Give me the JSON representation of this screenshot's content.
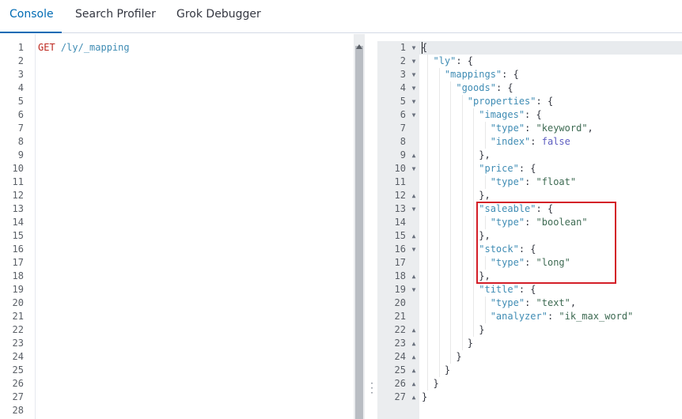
{
  "tabs": [
    {
      "label": "Console",
      "active": true
    },
    {
      "label": "Search Profiler",
      "active": false
    },
    {
      "label": "Grok Debugger",
      "active": false
    }
  ],
  "request": {
    "method": "GET",
    "path": "/ly/_mapping",
    "line_count": 28
  },
  "response": {
    "line_count": 27,
    "lines": [
      {
        "indent": 0,
        "fold": "down",
        "tokens": [
          {
            "t": "{",
            "c": "punc"
          }
        ]
      },
      {
        "indent": 1,
        "fold": "down",
        "tokens": [
          {
            "t": "\"ly\"",
            "c": "key"
          },
          {
            "t": ": {",
            "c": "punc"
          }
        ]
      },
      {
        "indent": 2,
        "fold": "down",
        "tokens": [
          {
            "t": "\"mappings\"",
            "c": "key"
          },
          {
            "t": ": {",
            "c": "punc"
          }
        ]
      },
      {
        "indent": 3,
        "fold": "down",
        "tokens": [
          {
            "t": "\"goods\"",
            "c": "key"
          },
          {
            "t": ": {",
            "c": "punc"
          }
        ]
      },
      {
        "indent": 4,
        "fold": "down",
        "tokens": [
          {
            "t": "\"properties\"",
            "c": "key"
          },
          {
            "t": ": {",
            "c": "punc"
          }
        ]
      },
      {
        "indent": 5,
        "fold": "down",
        "tokens": [
          {
            "t": "\"images\"",
            "c": "key"
          },
          {
            "t": ": {",
            "c": "punc"
          }
        ]
      },
      {
        "indent": 6,
        "fold": "",
        "tokens": [
          {
            "t": "\"type\"",
            "c": "key"
          },
          {
            "t": ": ",
            "c": "punc"
          },
          {
            "t": "\"keyword\"",
            "c": "str"
          },
          {
            "t": ",",
            "c": "punc"
          }
        ]
      },
      {
        "indent": 6,
        "fold": "",
        "tokens": [
          {
            "t": "\"index\"",
            "c": "key"
          },
          {
            "t": ": ",
            "c": "punc"
          },
          {
            "t": "false",
            "c": "bool"
          }
        ]
      },
      {
        "indent": 5,
        "fold": "up",
        "tokens": [
          {
            "t": "},",
            "c": "punc"
          }
        ]
      },
      {
        "indent": 5,
        "fold": "down",
        "tokens": [
          {
            "t": "\"price\"",
            "c": "key"
          },
          {
            "t": ": {",
            "c": "punc"
          }
        ]
      },
      {
        "indent": 6,
        "fold": "",
        "tokens": [
          {
            "t": "\"type\"",
            "c": "key"
          },
          {
            "t": ": ",
            "c": "punc"
          },
          {
            "t": "\"float\"",
            "c": "str"
          }
        ]
      },
      {
        "indent": 5,
        "fold": "up",
        "tokens": [
          {
            "t": "},",
            "c": "punc"
          }
        ]
      },
      {
        "indent": 5,
        "fold": "down",
        "tokens": [
          {
            "t": "\"saleable\"",
            "c": "key"
          },
          {
            "t": ": {",
            "c": "punc"
          }
        ]
      },
      {
        "indent": 6,
        "fold": "",
        "tokens": [
          {
            "t": "\"type\"",
            "c": "key"
          },
          {
            "t": ": ",
            "c": "punc"
          },
          {
            "t": "\"boolean\"",
            "c": "str"
          }
        ]
      },
      {
        "indent": 5,
        "fold": "up",
        "tokens": [
          {
            "t": "},",
            "c": "punc"
          }
        ]
      },
      {
        "indent": 5,
        "fold": "down",
        "tokens": [
          {
            "t": "\"stock\"",
            "c": "key"
          },
          {
            "t": ": {",
            "c": "punc"
          }
        ]
      },
      {
        "indent": 6,
        "fold": "",
        "tokens": [
          {
            "t": "\"type\"",
            "c": "key"
          },
          {
            "t": ": ",
            "c": "punc"
          },
          {
            "t": "\"long\"",
            "c": "str"
          }
        ]
      },
      {
        "indent": 5,
        "fold": "up",
        "tokens": [
          {
            "t": "},",
            "c": "punc"
          }
        ]
      },
      {
        "indent": 5,
        "fold": "down",
        "tokens": [
          {
            "t": "\"title\"",
            "c": "key"
          },
          {
            "t": ": {",
            "c": "punc"
          }
        ]
      },
      {
        "indent": 6,
        "fold": "",
        "tokens": [
          {
            "t": "\"type\"",
            "c": "key"
          },
          {
            "t": ": ",
            "c": "punc"
          },
          {
            "t": "\"text\"",
            "c": "str"
          },
          {
            "t": ",",
            "c": "punc"
          }
        ]
      },
      {
        "indent": 6,
        "fold": "",
        "tokens": [
          {
            "t": "\"analyzer\"",
            "c": "key"
          },
          {
            "t": ": ",
            "c": "punc"
          },
          {
            "t": "\"ik_max_word\"",
            "c": "str"
          }
        ]
      },
      {
        "indent": 5,
        "fold": "up",
        "tokens": [
          {
            "t": "}",
            "c": "punc"
          }
        ]
      },
      {
        "indent": 4,
        "fold": "up",
        "tokens": [
          {
            "t": "}",
            "c": "punc"
          }
        ]
      },
      {
        "indent": 3,
        "fold": "up",
        "tokens": [
          {
            "t": "}",
            "c": "punc"
          }
        ]
      },
      {
        "indent": 2,
        "fold": "up",
        "tokens": [
          {
            "t": "}",
            "c": "punc"
          }
        ]
      },
      {
        "indent": 1,
        "fold": "up",
        "tokens": [
          {
            "t": "}",
            "c": "punc"
          }
        ]
      },
      {
        "indent": 0,
        "fold": "up",
        "tokens": [
          {
            "t": "}",
            "c": "punc"
          }
        ]
      }
    ]
  },
  "icons": {
    "fold_down": "fold-down-icon",
    "fold_up": "fold-up-icon",
    "resize_handle": "vertical-ellipsis-icon"
  },
  "colors": {
    "accent": "#006bb4",
    "method": "#bd271e",
    "key": "#3f8cb4",
    "string": "#3d6a52",
    "boolean": "#5c5cc0",
    "highlight": "#d41e28"
  }
}
